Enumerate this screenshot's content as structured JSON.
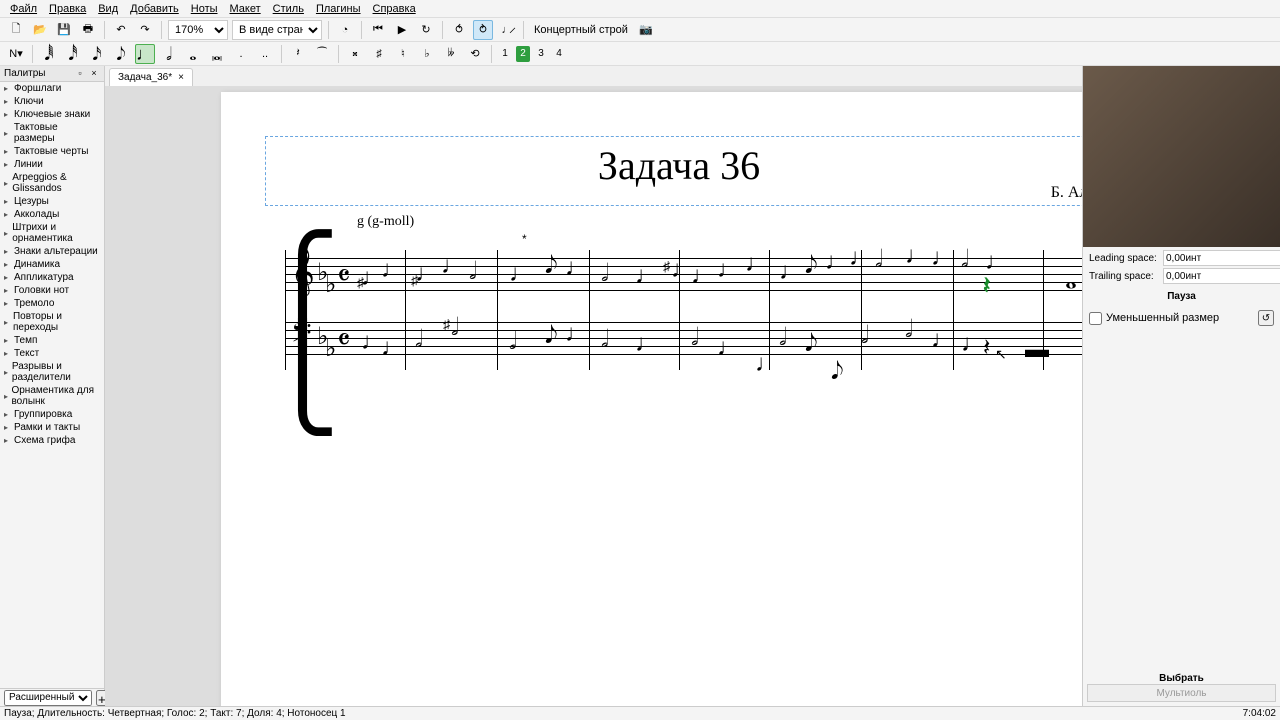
{
  "menu": [
    "Файл",
    "Правка",
    "Вид",
    "Добавить",
    "Ноты",
    "Макет",
    "Стиль",
    "Плагины",
    "Справка"
  ],
  "menu_underline_idx": [
    0,
    0,
    0,
    0,
    0,
    0,
    0,
    1,
    1
  ],
  "toolbar1": {
    "zoom": "170%",
    "view_mode": "В виде страниц",
    "concert_pitch": "Концертный строй"
  },
  "toolbar2": {
    "voices": [
      "1",
      "2",
      "3",
      "4"
    ],
    "active_voice": 1
  },
  "palette": {
    "title": "Палитры",
    "items": [
      "Форшлаги",
      "Ключи",
      "Ключевые знаки",
      "Тактовые размеры",
      "Тактовые черты",
      "Линии",
      "Arpeggios & Glissandos",
      "Цезуры",
      "Акколады",
      "Штрихи и орнаментика",
      "Знаки альтерации",
      "Динамика",
      "Аппликатура",
      "Головки нот",
      "Тремоло",
      "Повторы и переходы",
      "Темп",
      "Текст",
      "Разрывы и разделители",
      "Орнаментика для волынк",
      "Группировка",
      "Рамки и такты",
      "Схема грифа"
    ],
    "footer_mode": "Расширенный"
  },
  "tab": {
    "name": "Задача_36*",
    "close": "×"
  },
  "score": {
    "title": "Задача 36",
    "composer": "Б. Алексеев",
    "key_text": "g (g-moll)",
    "asterisk": "*"
  },
  "inspector": {
    "leading_label": "Leading space:",
    "leading_value": "0,00инт",
    "trailing_label": "Trailing space:",
    "trailing_value": "0,00инт",
    "section_pause": "Пауза",
    "small_label": "Уменьшенный размер",
    "select_label": "Выбрать",
    "multi_label": "Мультиоль"
  },
  "status": {
    "left": "Пауза; Длительность: Четвертная; Голос: 2; Такт: 7; Доля: 4; Нотоносец 1",
    "right": "7:04:02"
  }
}
